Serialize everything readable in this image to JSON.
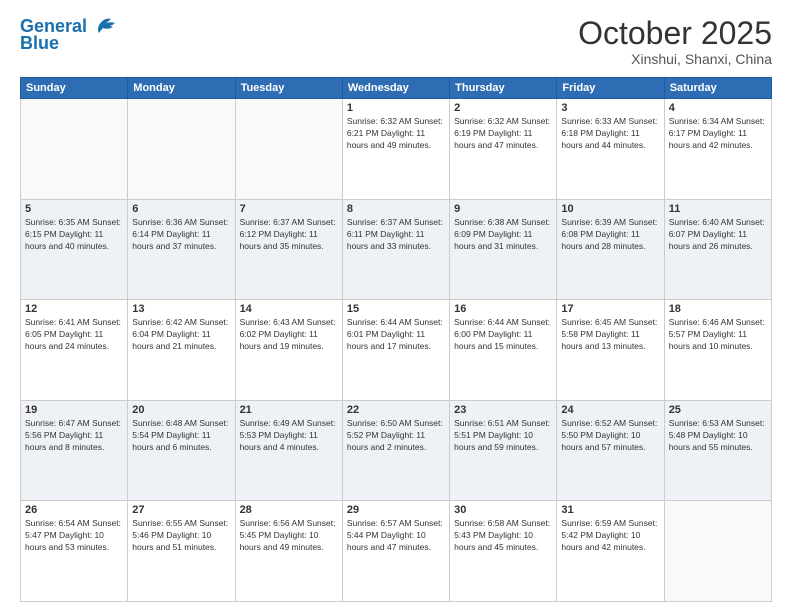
{
  "logo": {
    "line1": "General",
    "line2": "Blue"
  },
  "title": "October 2025",
  "location": "Xinshui, Shanxi, China",
  "weekdays": [
    "Sunday",
    "Monday",
    "Tuesday",
    "Wednesday",
    "Thursday",
    "Friday",
    "Saturday"
  ],
  "weeks": [
    [
      {
        "day": "",
        "info": ""
      },
      {
        "day": "",
        "info": ""
      },
      {
        "day": "",
        "info": ""
      },
      {
        "day": "1",
        "info": "Sunrise: 6:32 AM\nSunset: 6:21 PM\nDaylight: 11 hours\nand 49 minutes."
      },
      {
        "day": "2",
        "info": "Sunrise: 6:32 AM\nSunset: 6:19 PM\nDaylight: 11 hours\nand 47 minutes."
      },
      {
        "day": "3",
        "info": "Sunrise: 6:33 AM\nSunset: 6:18 PM\nDaylight: 11 hours\nand 44 minutes."
      },
      {
        "day": "4",
        "info": "Sunrise: 6:34 AM\nSunset: 6:17 PM\nDaylight: 11 hours\nand 42 minutes."
      }
    ],
    [
      {
        "day": "5",
        "info": "Sunrise: 6:35 AM\nSunset: 6:15 PM\nDaylight: 11 hours\nand 40 minutes."
      },
      {
        "day": "6",
        "info": "Sunrise: 6:36 AM\nSunset: 6:14 PM\nDaylight: 11 hours\nand 37 minutes."
      },
      {
        "day": "7",
        "info": "Sunrise: 6:37 AM\nSunset: 6:12 PM\nDaylight: 11 hours\nand 35 minutes."
      },
      {
        "day": "8",
        "info": "Sunrise: 6:37 AM\nSunset: 6:11 PM\nDaylight: 11 hours\nand 33 minutes."
      },
      {
        "day": "9",
        "info": "Sunrise: 6:38 AM\nSunset: 6:09 PM\nDaylight: 11 hours\nand 31 minutes."
      },
      {
        "day": "10",
        "info": "Sunrise: 6:39 AM\nSunset: 6:08 PM\nDaylight: 11 hours\nand 28 minutes."
      },
      {
        "day": "11",
        "info": "Sunrise: 6:40 AM\nSunset: 6:07 PM\nDaylight: 11 hours\nand 26 minutes."
      }
    ],
    [
      {
        "day": "12",
        "info": "Sunrise: 6:41 AM\nSunset: 6:05 PM\nDaylight: 11 hours\nand 24 minutes."
      },
      {
        "day": "13",
        "info": "Sunrise: 6:42 AM\nSunset: 6:04 PM\nDaylight: 11 hours\nand 21 minutes."
      },
      {
        "day": "14",
        "info": "Sunrise: 6:43 AM\nSunset: 6:02 PM\nDaylight: 11 hours\nand 19 minutes."
      },
      {
        "day": "15",
        "info": "Sunrise: 6:44 AM\nSunset: 6:01 PM\nDaylight: 11 hours\nand 17 minutes."
      },
      {
        "day": "16",
        "info": "Sunrise: 6:44 AM\nSunset: 6:00 PM\nDaylight: 11 hours\nand 15 minutes."
      },
      {
        "day": "17",
        "info": "Sunrise: 6:45 AM\nSunset: 5:58 PM\nDaylight: 11 hours\nand 13 minutes."
      },
      {
        "day": "18",
        "info": "Sunrise: 6:46 AM\nSunset: 5:57 PM\nDaylight: 11 hours\nand 10 minutes."
      }
    ],
    [
      {
        "day": "19",
        "info": "Sunrise: 6:47 AM\nSunset: 5:56 PM\nDaylight: 11 hours\nand 8 minutes."
      },
      {
        "day": "20",
        "info": "Sunrise: 6:48 AM\nSunset: 5:54 PM\nDaylight: 11 hours\nand 6 minutes."
      },
      {
        "day": "21",
        "info": "Sunrise: 6:49 AM\nSunset: 5:53 PM\nDaylight: 11 hours\nand 4 minutes."
      },
      {
        "day": "22",
        "info": "Sunrise: 6:50 AM\nSunset: 5:52 PM\nDaylight: 11 hours\nand 2 minutes."
      },
      {
        "day": "23",
        "info": "Sunrise: 6:51 AM\nSunset: 5:51 PM\nDaylight: 10 hours\nand 59 minutes."
      },
      {
        "day": "24",
        "info": "Sunrise: 6:52 AM\nSunset: 5:50 PM\nDaylight: 10 hours\nand 57 minutes."
      },
      {
        "day": "25",
        "info": "Sunrise: 6:53 AM\nSunset: 5:48 PM\nDaylight: 10 hours\nand 55 minutes."
      }
    ],
    [
      {
        "day": "26",
        "info": "Sunrise: 6:54 AM\nSunset: 5:47 PM\nDaylight: 10 hours\nand 53 minutes."
      },
      {
        "day": "27",
        "info": "Sunrise: 6:55 AM\nSunset: 5:46 PM\nDaylight: 10 hours\nand 51 minutes."
      },
      {
        "day": "28",
        "info": "Sunrise: 6:56 AM\nSunset: 5:45 PM\nDaylight: 10 hours\nand 49 minutes."
      },
      {
        "day": "29",
        "info": "Sunrise: 6:57 AM\nSunset: 5:44 PM\nDaylight: 10 hours\nand 47 minutes."
      },
      {
        "day": "30",
        "info": "Sunrise: 6:58 AM\nSunset: 5:43 PM\nDaylight: 10 hours\nand 45 minutes."
      },
      {
        "day": "31",
        "info": "Sunrise: 6:59 AM\nSunset: 5:42 PM\nDaylight: 10 hours\nand 42 minutes."
      },
      {
        "day": "",
        "info": ""
      }
    ]
  ]
}
